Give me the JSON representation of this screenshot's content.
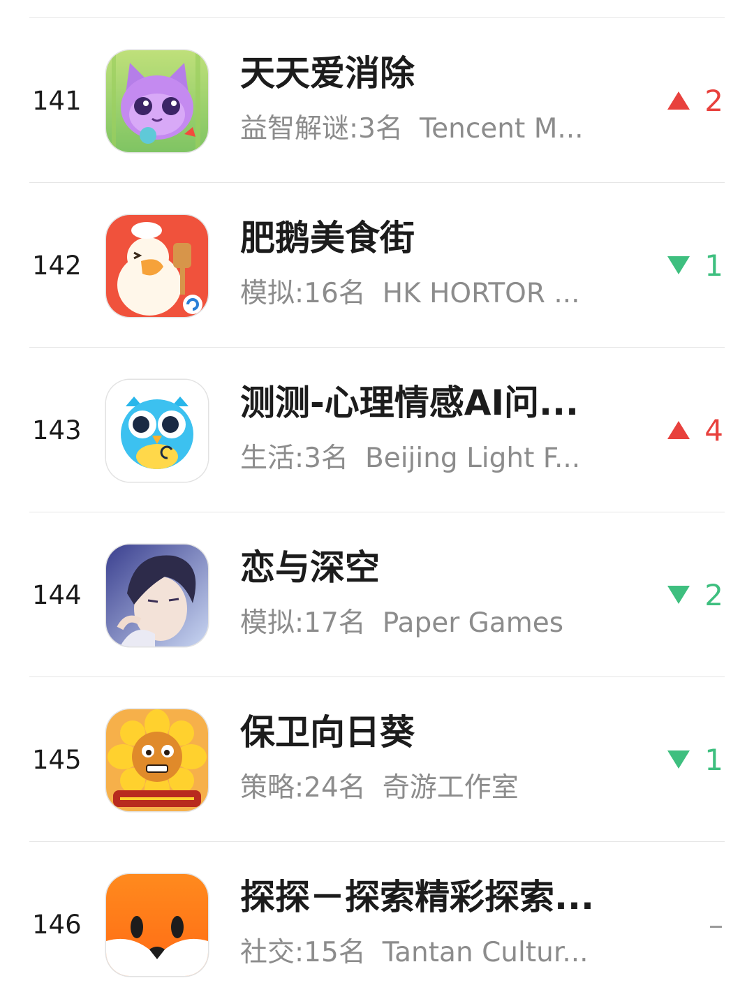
{
  "colors": {
    "up": "#e8413d",
    "down": "#3ebf7f",
    "neutral": "#9a9a9a",
    "subtext": "#8c8c8c"
  },
  "apps": [
    {
      "rank": "141",
      "title": "天天爱消除",
      "category": "益智解谜:3名",
      "developer": "Tencent M...",
      "trend": "up",
      "change": "2",
      "icon": "purple-cat-icon"
    },
    {
      "rank": "142",
      "title": "肥鹅美食街",
      "category": "模拟:16名",
      "developer": "HK HORTOR ...",
      "trend": "down",
      "change": "1",
      "icon": "chef-goose-icon"
    },
    {
      "rank": "143",
      "title": "测测-心理情感AI问...",
      "category": "生活:3名",
      "developer": "Beijing Light F...",
      "trend": "up",
      "change": "4",
      "icon": "blue-owl-icon"
    },
    {
      "rank": "144",
      "title": "恋与深空",
      "category": "模拟:17名",
      "developer": "Paper Games",
      "trend": "down",
      "change": "2",
      "icon": "anime-boy-icon"
    },
    {
      "rank": "145",
      "title": "保卫向日葵",
      "category": "策略:24名",
      "developer": "奇游工作室",
      "trend": "down",
      "change": "1",
      "icon": "sunflower-icon"
    },
    {
      "rank": "146",
      "title": "探探－探索精彩探索...",
      "category": "社交:15名",
      "developer": "Tantan Cultur...",
      "trend": "none",
      "change": "–",
      "icon": "orange-fox-icon"
    }
  ]
}
